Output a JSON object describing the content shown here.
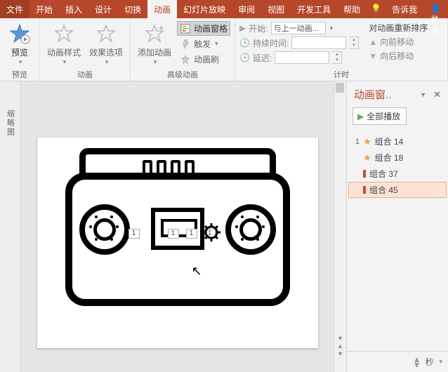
{
  "tabs": {
    "file": "文件",
    "home": "开始",
    "insert": "插入",
    "design": "设计",
    "transition": "切换",
    "animation": "动画",
    "slideshow": "幻灯片放映",
    "review": "审阅",
    "view": "视图",
    "dev": "开发工具",
    "help": "帮助",
    "tellme": "告诉我",
    "share": "共享"
  },
  "ribbon": {
    "preview": {
      "label": "预览",
      "group": "预览"
    },
    "anim": {
      "style": "动画样式",
      "effect": "效果选项",
      "group": "动画"
    },
    "advanced": {
      "add": "添加动画",
      "pane": "动画窗格",
      "trigger": "触发",
      "painter": "动画刷",
      "group": "高级动画"
    },
    "timing": {
      "start": "开始:",
      "start_val": "与上一动画...",
      "duration": "持续时间:",
      "delay": "延迟:",
      "reorder": "对动画重新排序",
      "fwd": "向前移动",
      "back": "向后移动",
      "group": "计时"
    }
  },
  "pane": {
    "title": "动画窗..",
    "playall": "全部播放",
    "items": [
      {
        "num": "1",
        "type": "star",
        "label": "组合 14"
      },
      {
        "num": "",
        "type": "star",
        "label": "组合 18"
      },
      {
        "num": "",
        "type": "bar",
        "label": "组合 37"
      },
      {
        "num": "",
        "type": "bar",
        "label": "组合 45",
        "selected": true
      }
    ],
    "seconds": "秒"
  },
  "thumb": "缩略图",
  "anim_tag": "1"
}
